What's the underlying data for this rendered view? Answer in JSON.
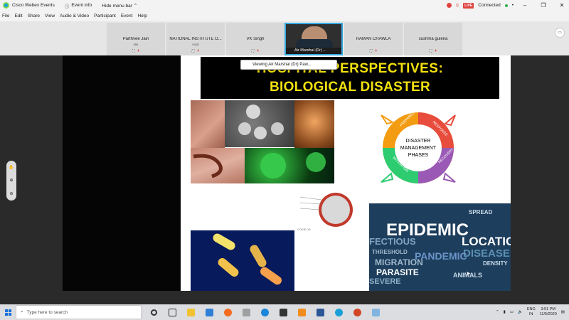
{
  "titlebar": {
    "app_title": "Cisco Webex Events",
    "event_info": "Event info",
    "hide_menu": "Hide menu bar",
    "live_badge": "LIVE",
    "status": "Connected"
  },
  "menu": [
    "File",
    "Edit",
    "Share",
    "View",
    "Audio & Video",
    "Participant",
    "Event",
    "Help"
  ],
  "participants": [
    {
      "name": "Parthvee Jain",
      "role": "Me"
    },
    {
      "name": "NATIONAL INSTITUTE O...",
      "role": "Host"
    },
    {
      "name": "VK Singh",
      "role": ""
    },
    {
      "name": "Air Marshal (Dr) ...",
      "role": "",
      "active": true
    },
    {
      "name": "RAMAN CHAWLA",
      "role": ""
    },
    {
      "name": "sushma guleria",
      "role": ""
    }
  ],
  "tooltip": "Viewing Air Marshal (Dr) Paw...",
  "slide": {
    "title_line1": "HOSPITAL PERSPECTIVES:",
    "title_line2": "BIOLOGICAL DISASTER",
    "cycle_center": [
      "DISASTER",
      "MANAGEMENT",
      "PHASES"
    ],
    "cycle_labels": [
      "PREPAREDNESS",
      "RESPONSE",
      "RECOVERY",
      "MITIGATION"
    ],
    "corona_caption": "COVID-19",
    "wordcloud": [
      "EPIDEMIC",
      "LOCATION",
      "DISEASE",
      "PANDEMIC",
      "MIGRATION",
      "PARASITE",
      "FECTIOUS",
      "THRESHOLD",
      "SEVERE",
      "DENSITY",
      "ANIMALS",
      "SPREAD"
    ]
  },
  "taskbar": {
    "search_placeholder": "Type here to search",
    "lang_1": "ENG",
    "lang_2": "IN",
    "time": "3:51 PM",
    "date": "11/5/2020"
  },
  "colors": {
    "title_yellow": "#f3e10e",
    "slide_bg": "#ffffff",
    "share_bg": "#050505",
    "accent_blue": "#36a9e1"
  }
}
